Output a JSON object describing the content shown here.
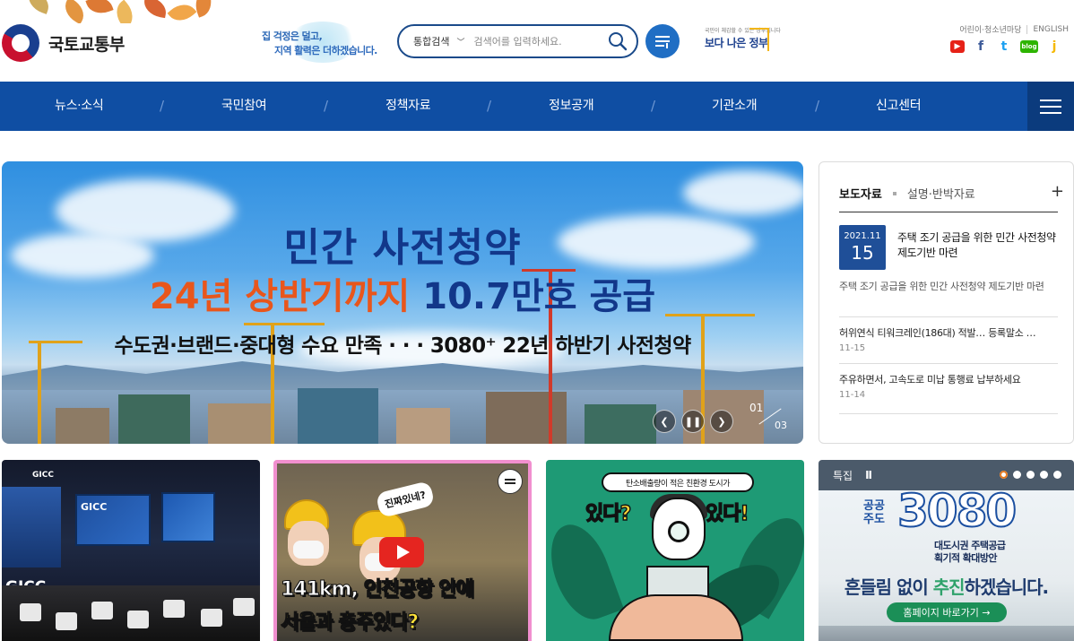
{
  "header": {
    "logo_text": "국토교통부",
    "slogan_line1": "집 걱정은 덜고,",
    "slogan_line2": "지역 활력은 더하겠습니다.",
    "search": {
      "scope_label": "통합검색",
      "placeholder": "검색어를 입력하세요."
    },
    "gov_badge_small": "국민이 체감할 수 있는 정부입니다",
    "gov_badge_big": "보다 나은 정부",
    "util_links": [
      "어린이·청소년마당",
      "ENGLISH"
    ],
    "social": [
      {
        "icon": "youtube-icon",
        "label": "▶",
        "color": "#e62117"
      },
      {
        "icon": "facebook-icon",
        "label": "f",
        "color": "#3b5998"
      },
      {
        "icon": "twitter-icon",
        "label": "t",
        "color": "#1da1f2"
      },
      {
        "icon": "blog-icon",
        "label": "blog",
        "color": "#2db400"
      },
      {
        "icon": "kakao-story-icon",
        "label": "j",
        "color": "#f5b800"
      }
    ]
  },
  "nav": {
    "items": [
      "뉴스·소식",
      "국민참여",
      "정책자료",
      "정보공개",
      "기관소개",
      "신고센터"
    ]
  },
  "hero": {
    "title1": "민간 사전청약",
    "title2_a": "24년 상반기까지 ",
    "title2_b": "10.7만호 공급",
    "title3": "수도권·브랜드·중대형 수요 만족 · · · 3080⁺ 22년 하반기 사전청약",
    "current_page": "01",
    "total_pages": "03"
  },
  "press": {
    "tab_active": "보도자료",
    "tab_other": "설명·반박자료",
    "top": {
      "date_ym": "2021.11",
      "date_d": "15",
      "title": "주택 조기 공급을 위한 민간 사전청약 제도기반 마련",
      "desc": "주택 조기 공급을 위한 민간 사전청약 제도기반 마련"
    },
    "items": [
      {
        "title": "허위연식 티워크레인(186대) 적발… 등록말소 …",
        "date": "11-15"
      },
      {
        "title": "주유하면서, 고속도로 미납 통행료 납부하세요",
        "date": "11-14"
      }
    ]
  },
  "cards": {
    "card2": {
      "bubble": "진짜있네?",
      "line1": "141km, 인천공항 안에",
      "line2": "서울과 충주있다?"
    },
    "card3": {
      "banner": "탄소배출량이 적은 친환경 도시가",
      "q1": "있다?",
      "q2": "있다!"
    },
    "card4": {
      "label": "특집",
      "pause": "II",
      "kk": "공공\n주도",
      "number": "3080",
      "sub1": "대도시권 주택공급",
      "sub2": "획기적 확대방안",
      "main_a": "흔들림 없이 ",
      "main_b": "추진",
      "main_c": "하겠습니다.",
      "button": "홈페이지 바로가기 →"
    }
  },
  "colors": {
    "nav_bg": "#0f4ea3",
    "brand_blue": "#1f4f98",
    "accent_orange": "#e8561c"
  }
}
